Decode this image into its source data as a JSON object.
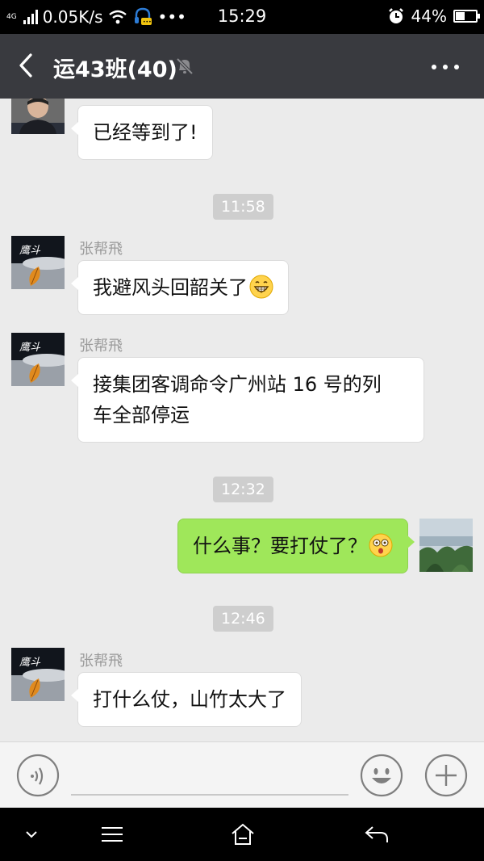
{
  "status_bar": {
    "network_type": "4G",
    "speed": "0.05K/s",
    "time": "15:29",
    "battery_percent": "44%",
    "battery_level": 0.44
  },
  "header": {
    "title": "运43班(40)",
    "back_icon": "chevron-left-icon",
    "mute_icon": "bell-off-icon",
    "more_icon": "more-dots-icon"
  },
  "messages": [
    {
      "type": "text",
      "side": "left",
      "text": "已经等到了!"
    },
    {
      "type": "time",
      "text": "11:58"
    },
    {
      "type": "text",
      "side": "left",
      "sender": "张帮飛",
      "text": "我避风头回韶关了",
      "emoji": "grin"
    },
    {
      "type": "text",
      "side": "left",
      "sender": "张帮飛",
      "line1": "接集团客调命令广州站 16 号的列",
      "line2": "车全部停运"
    },
    {
      "type": "time",
      "text": "12:32"
    },
    {
      "type": "text",
      "side": "right",
      "text": "什么事？要打仗了？",
      "emoji": "dazed"
    },
    {
      "type": "time",
      "text": "12:46"
    },
    {
      "type": "text",
      "side": "left",
      "sender": "张帮飛",
      "text": "打什么仗，山竹太大了"
    }
  ],
  "input_bar": {
    "voice_icon": "voice-icon",
    "emoji_icon": "smiley-icon",
    "plus_icon": "plus-icon"
  },
  "nav_bar": {
    "icons": [
      "chevron-down-icon",
      "menu-icon",
      "home-icon",
      "back-arrow-icon"
    ]
  },
  "colors": {
    "header_bg": "#393a3f",
    "chat_bg": "#ebebeb",
    "own_bubble": "#9fe75a",
    "other_bubble": "#ffffff"
  }
}
